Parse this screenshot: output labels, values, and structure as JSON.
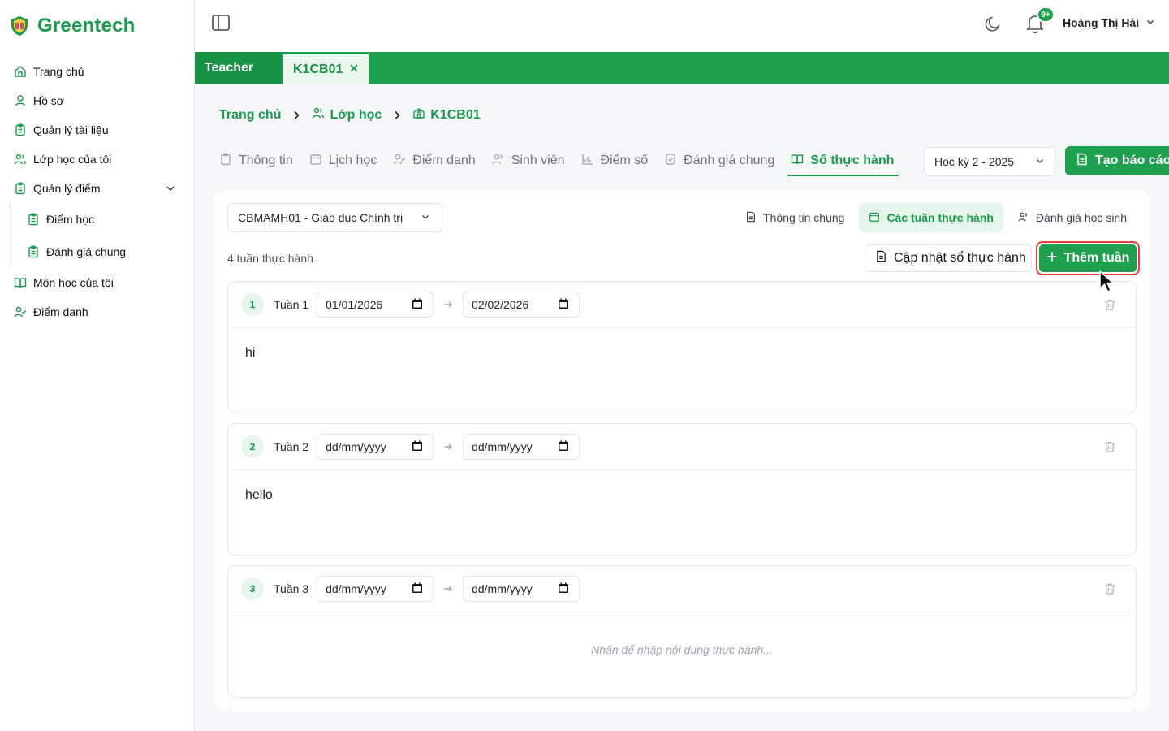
{
  "app": {
    "name": "Greentech",
    "brand_color": "#1a9b4b"
  },
  "sidebar": {
    "items": [
      {
        "label": "Trang chủ",
        "icon": "home-icon"
      },
      {
        "label": "Hồ sơ",
        "icon": "user-icon"
      },
      {
        "label": "Quản lý tài liệu",
        "icon": "clipboard-icon"
      },
      {
        "label": "Lớp học của tôi",
        "icon": "users-icon"
      },
      {
        "label": "Quản lý điểm",
        "icon": "clipboard-icon",
        "expanded": true
      },
      {
        "label": "Điểm học",
        "icon": "clipboard-icon"
      },
      {
        "label": "Đánh giá chung",
        "icon": "clipboard-icon"
      },
      {
        "label": "Môn học của tôi",
        "icon": "book-icon"
      },
      {
        "label": "Điểm danh",
        "icon": "user-check-icon"
      }
    ]
  },
  "header": {
    "notification_badge": "9+",
    "user_name": "Hoàng Thị Hải"
  },
  "tabs": {
    "teacher": "Teacher",
    "active": "K1CB01"
  },
  "breadcrumb": [
    "Trang chủ",
    "Lớp học",
    "K1CB01"
  ],
  "section_tabs": [
    {
      "label": "Thông tin",
      "icon": "clipboard-icon"
    },
    {
      "label": "Lịch học",
      "icon": "calendar-icon"
    },
    {
      "label": "Điểm danh",
      "icon": "user-check-icon"
    },
    {
      "label": "Sinh viên",
      "icon": "users-icon"
    },
    {
      "label": "Điểm số",
      "icon": "bar-chart-icon"
    },
    {
      "label": "Đánh giá chung",
      "icon": "checklist-icon"
    },
    {
      "label": "Sổ thực hành",
      "icon": "book-icon",
      "active": true
    }
  ],
  "term_select": "Học kỳ 2 - 2025",
  "report_button": "Tạo báo cáo",
  "practice": {
    "subject_select": "CBMAMH01 - Giáo dục Chính trị",
    "subnav": [
      {
        "label": "Thông tin chung",
        "icon": "document-icon"
      },
      {
        "label": "Các tuần thực hành",
        "icon": "calendar-icon",
        "active": true
      },
      {
        "label": "Đánh giá học sinh",
        "icon": "users-icon"
      }
    ],
    "week_count": "4 tuần thực hành",
    "update_button": "Cập nhật sổ thực hành",
    "add_button": "Thêm tuần",
    "weeks": [
      {
        "num": "1",
        "label": "Tuần 1",
        "start": "01/01/2026",
        "end": "02/02/2026",
        "content": "hi"
      },
      {
        "num": "2",
        "label": "Tuần 2",
        "start": "dd/mm/yyyy",
        "end": "dd/mm/yyyy",
        "content": "hello"
      },
      {
        "num": "3",
        "label": "Tuần 3",
        "start": "dd/mm/yyyy",
        "end": "dd/mm/yyyy",
        "content": "",
        "placeholder": "Nhấn để nhập nội dung thực hành..."
      }
    ]
  }
}
